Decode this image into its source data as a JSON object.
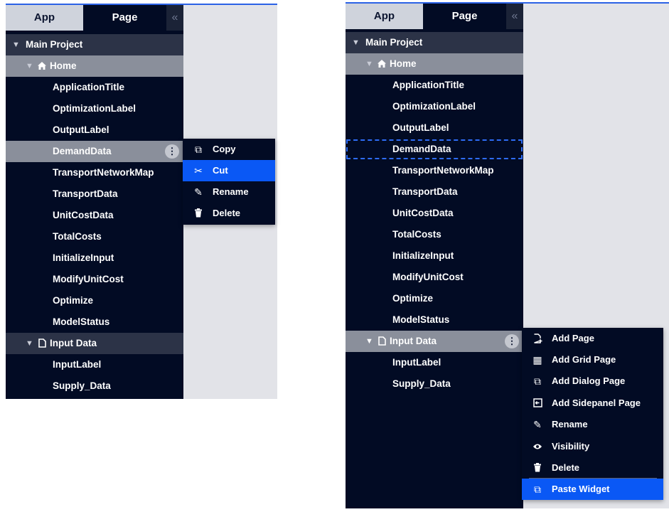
{
  "tabs": {
    "app": "App",
    "page": "Page",
    "collapse": "«"
  },
  "tree": {
    "root": "Main Project",
    "home": "Home",
    "home_children": [
      "ApplicationTitle",
      "OptimizationLabel",
      "OutputLabel",
      "DemandData",
      "TransportNetworkMap",
      "TransportData",
      "UnitCostData",
      "TotalCosts",
      "InitializeInput",
      "ModifyUnitCost",
      "Optimize",
      "ModelStatus"
    ],
    "input_data": "Input Data",
    "input_children": [
      "InputLabel",
      "Supply_Data"
    ]
  },
  "widget_menu": {
    "copy": "Copy",
    "cut": "Cut",
    "rename": "Rename",
    "delete": "Delete"
  },
  "page_menu": {
    "add_page": "Add Page",
    "add_grid_page": "Add Grid Page",
    "add_dialog_page": "Add Dialog Page",
    "add_sidepanel_page": "Add Sidepanel Page",
    "rename": "Rename",
    "visibility": "Visibility",
    "delete": "Delete",
    "paste_widget": "Paste Widget"
  },
  "icons": [
    "home-icon",
    "page-icon",
    "kebab-icon",
    "copy-icon",
    "cut-icon",
    "rename-icon",
    "delete-icon",
    "add-page-icon",
    "grid-icon",
    "dialog-icon",
    "sidepanel-icon",
    "visibility-icon",
    "paste-icon"
  ],
  "colors": {
    "sidebar_bg": "#020b24",
    "selected_row": "#8a8f9b",
    "highlight": "#0a58f5",
    "dashed_outline": "#2e6cf5",
    "canvas_bg": "#e2e3e8"
  }
}
